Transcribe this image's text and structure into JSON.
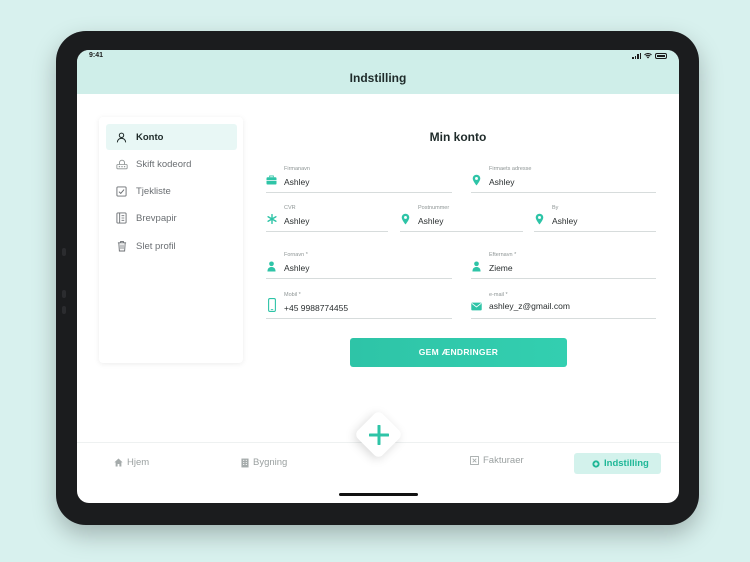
{
  "status_bar": {
    "time": "9:41"
  },
  "header": {
    "title": "Indstilling"
  },
  "sidebar": {
    "items": [
      {
        "label": "Konto",
        "icon": "user-icon",
        "active": true
      },
      {
        "label": "Skift kodeord",
        "icon": "password-icon",
        "active": false
      },
      {
        "label": "Tjekliste",
        "icon": "checklist-icon",
        "active": false
      },
      {
        "label": "Brevpapir",
        "icon": "letterhead-icon",
        "active": false
      },
      {
        "label": "Slet profil",
        "icon": "trash-icon",
        "active": false
      }
    ]
  },
  "form": {
    "title": "Min konto",
    "fields": {
      "company_name": {
        "label": "Firmanavn",
        "value": "Ashley",
        "icon": "briefcase-icon"
      },
      "company_address": {
        "label": "Firmaets adresse",
        "value": "Ashley",
        "icon": "location-pin-icon"
      },
      "cvr": {
        "label": "CVR",
        "value": "Ashley",
        "icon": "asterisk-icon"
      },
      "postal_code": {
        "label": "Postnummer",
        "value": "Ashley",
        "icon": "location-pin-icon"
      },
      "city": {
        "label": "By",
        "value": "Ashley",
        "icon": "location-pin-icon"
      },
      "first_name": {
        "label": "Fornavn *",
        "value": "Ashley",
        "icon": "person-icon"
      },
      "last_name": {
        "label": "Efternavn *",
        "value": "Zieme",
        "icon": "person-icon"
      },
      "mobile": {
        "label": "Mobil *",
        "value": "+45 9988774455",
        "icon": "phone-icon"
      },
      "email": {
        "label": "e-mail *",
        "value": "ashley_z@gmail.com",
        "icon": "envelope-icon"
      }
    },
    "save_label": "GEM ÆNDRINGER"
  },
  "bottom_nav": {
    "items": [
      {
        "label": "Hjem",
        "icon": "home-icon"
      },
      {
        "label": "Bygning",
        "icon": "building-icon"
      },
      {
        "label": "Fakturaer",
        "icon": "invoice-icon"
      },
      {
        "label": "Indstilling",
        "icon": "settings-icon",
        "active": true
      }
    ]
  },
  "colors": {
    "accent": "#2ec4a7",
    "header_bg": "#cfeee9",
    "background": "#d8f1ee"
  }
}
